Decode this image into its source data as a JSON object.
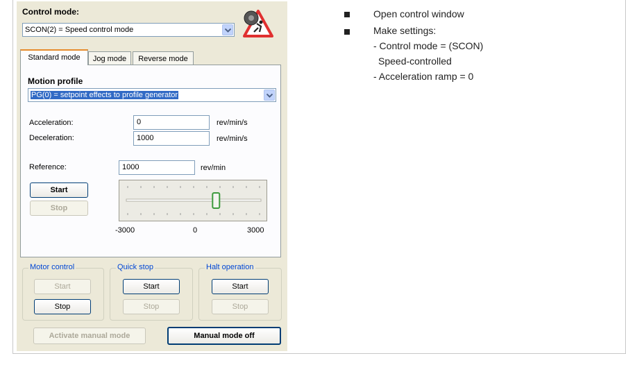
{
  "control_mode": {
    "label": "Control mode:",
    "selected": "SCON(2) = Speed control mode"
  },
  "tabs": [
    "Standard mode",
    "Jog mode",
    "Reverse mode"
  ],
  "motion_profile": {
    "label": "Motion profile",
    "selected": "PG(0) = setpoint effects to profile generator"
  },
  "acceleration": {
    "label": "Acceleration:",
    "value": "0",
    "unit": "rev/min/s"
  },
  "deceleration": {
    "label": "Deceleration:",
    "value": "1000",
    "unit": "rev/min/s"
  },
  "reference": {
    "label": "Reference:",
    "value": "1000",
    "unit": "rev/min"
  },
  "standard_buttons": {
    "start": "Start",
    "stop": "Stop"
  },
  "slider": {
    "min_label": "-3000",
    "mid_label": "0",
    "max_label": "3000",
    "value": 1000,
    "min": -3000,
    "max": 3000
  },
  "groups": {
    "motor_control": {
      "label": "Motor control",
      "start": "Start",
      "stop": "Stop"
    },
    "quick_stop": {
      "label": "Quick stop",
      "start": "Start",
      "stop": "Stop"
    },
    "halt_operation": {
      "label": "Halt operation",
      "start": "Start",
      "stop": "Stop"
    }
  },
  "bottom_buttons": {
    "activate": "Activate manual mode",
    "off": "Manual mode off"
  },
  "instructions": {
    "item1": "Open control window",
    "item2": "Make settings:",
    "sub1a": "- Control mode = (SCON)",
    "sub1b": "Speed-controlled",
    "sub2": "- Acceleration ramp = 0"
  },
  "colors": {
    "panel_bg": "#ece9d8",
    "group_label": "#0046d5",
    "selection": "#316ac5",
    "tab_accent": "#e68b2c"
  }
}
